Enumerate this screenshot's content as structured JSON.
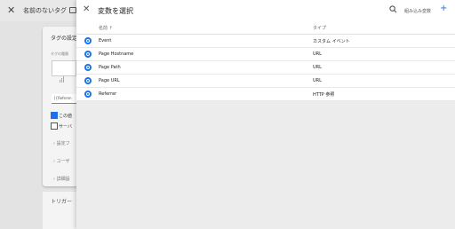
{
  "background": {
    "title": "名前のないタグ",
    "card_title": "タグの設定",
    "tag_type_label": "タグの種類",
    "selected_tag_code": "{{Referen",
    "checkbox1_label": "この値",
    "checkbox2_label": "サーバ",
    "expand1": "› 設定フ",
    "expand2": "› ユーザ",
    "expand3": "› 詳細設",
    "trigger_title": "トリガー"
  },
  "panel": {
    "title": "変数を選択",
    "builtin_label": "組み込み変数",
    "add_icon": "+",
    "columns": {
      "name": "名前 ↑",
      "type": "タイプ"
    },
    "rows": [
      {
        "name": "Event",
        "type": "カスタム イベント"
      },
      {
        "name": "Page Hostname",
        "type": "URL"
      },
      {
        "name": "Page Path",
        "type": "URL"
      },
      {
        "name": "Page URL",
        "type": "URL"
      },
      {
        "name": "Referrer",
        "type": "HTTP 参照"
      }
    ]
  },
  "colors": {
    "accent": "#1a73e8"
  }
}
